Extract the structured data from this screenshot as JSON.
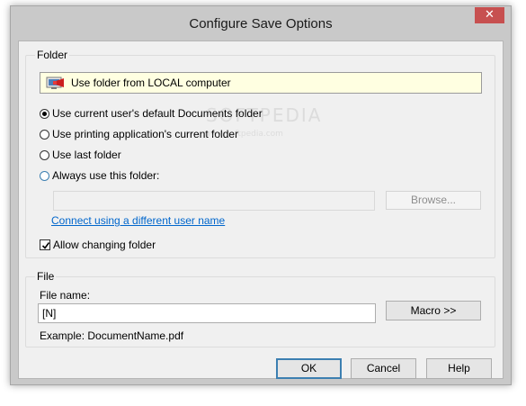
{
  "window": {
    "title": "Configure Save Options",
    "close_glyph": "✕"
  },
  "folder_group": {
    "label": "Folder",
    "banner_text": "Use folder from LOCAL computer",
    "banner_icon": "computer-icon",
    "options": [
      {
        "label": "Use current user's default Documents folder",
        "selected": true
      },
      {
        "label": "Use printing application's current folder",
        "selected": false
      },
      {
        "label": "Use last folder",
        "selected": false
      },
      {
        "label": "Always use this folder:",
        "selected": false
      }
    ],
    "folder_path_value": "",
    "browse_label": "Browse...",
    "connect_link": "Connect using a different user name",
    "allow_changing_label": "Allow changing folder",
    "allow_changing_checked": true
  },
  "file_group": {
    "label": "File",
    "file_name_label": "File name:",
    "file_name_value": "[N]",
    "macro_label": "Macro >>",
    "example_text": "Example: DocumentName.pdf"
  },
  "buttons": {
    "ok": "OK",
    "cancel": "Cancel",
    "help": "Help"
  },
  "watermark": {
    "text": "SOFTPEDIA",
    "subtext": "www.softpedia.com"
  },
  "colors": {
    "close_button": "#c75050",
    "banner_bg": "#ffffe1",
    "link": "#0066cc",
    "focus_border": "#3c7fb1"
  }
}
